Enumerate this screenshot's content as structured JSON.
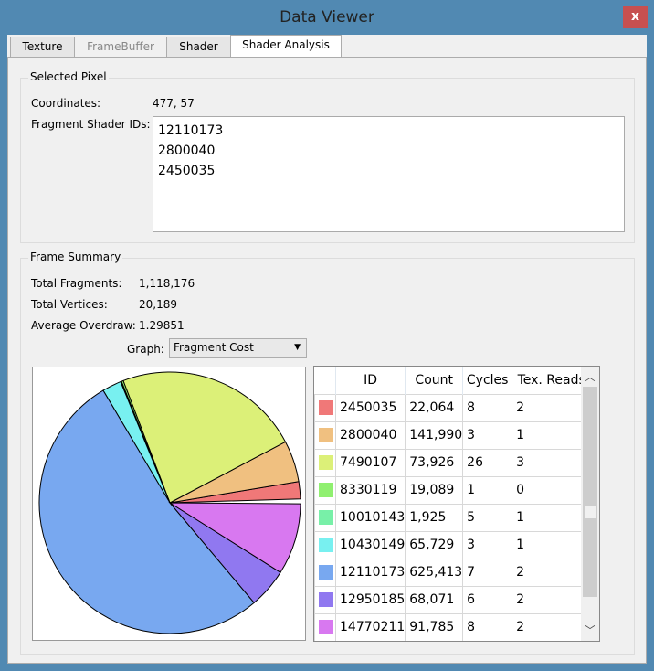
{
  "window": {
    "title": "Data Viewer",
    "close_label": "x"
  },
  "tabs": [
    {
      "label": "Texture"
    },
    {
      "label": "FrameBuffer"
    },
    {
      "label": "Shader"
    },
    {
      "label": "Shader Analysis"
    }
  ],
  "selected_pixel": {
    "title": "Selected Pixel",
    "coord_label": "Coordinates:",
    "coord_value": "477, 57",
    "ids_label": "Fragment Shader IDs:",
    "ids": [
      "12110173",
      "2800040",
      "2450035"
    ]
  },
  "frame_summary": {
    "title": "Frame Summary",
    "frag_label": "Total Fragments:",
    "frag_value": "1,118,176",
    "vert_label": "Total Vertices:",
    "vert_value": "20,189",
    "overdraw_label": "Average Overdraw:",
    "overdraw_value": "1.29851",
    "graph_label": "Graph:",
    "graph_value": "Fragment Cost"
  },
  "table": {
    "headers": [
      "",
      "ID",
      "Count",
      "Cycles",
      "Tex. Reads"
    ],
    "rows": [
      {
        "color": "#f07878",
        "id": "2450035",
        "count": "22,064",
        "cycles": "8",
        "tex": "2"
      },
      {
        "color": "#f0c080",
        "id": "2800040",
        "count": "141,990",
        "cycles": "3",
        "tex": "1"
      },
      {
        "color": "#dcf078",
        "id": "7490107",
        "count": "73,926",
        "cycles": "26",
        "tex": "3"
      },
      {
        "color": "#90f070",
        "id": "8330119",
        "count": "19,089",
        "cycles": "1",
        "tex": "0"
      },
      {
        "color": "#78f0a8",
        "id": "10010143",
        "count": "1,925",
        "cycles": "5",
        "tex": "1"
      },
      {
        "color": "#78f0f0",
        "id": "10430149",
        "count": "65,729",
        "cycles": "3",
        "tex": "1"
      },
      {
        "color": "#78a8f0",
        "id": "12110173",
        "count": "625,413",
        "cycles": "7",
        "tex": "2"
      },
      {
        "color": "#9078f0",
        "id": "12950185",
        "count": "68,071",
        "cycles": "6",
        "tex": "2"
      },
      {
        "color": "#d878f0",
        "id": "14770211",
        "count": "91,785",
        "cycles": "8",
        "tex": "2"
      }
    ]
  },
  "chart_data": {
    "type": "pie",
    "title": "Fragment Cost",
    "labels": [
      "2450035",
      "2800040",
      "7490107",
      "8330119",
      "10010143",
      "10430149",
      "12110173",
      "12950185",
      "14770211"
    ],
    "values": [
      176512,
      425970,
      1922076,
      19089,
      9625,
      197187,
      4377891,
      408426,
      734280
    ],
    "colors": [
      "#f07878",
      "#f0c080",
      "#dcf078",
      "#90f070",
      "#78f0a8",
      "#78f0f0",
      "#78a8f0",
      "#9078f0",
      "#d878f0"
    ]
  }
}
